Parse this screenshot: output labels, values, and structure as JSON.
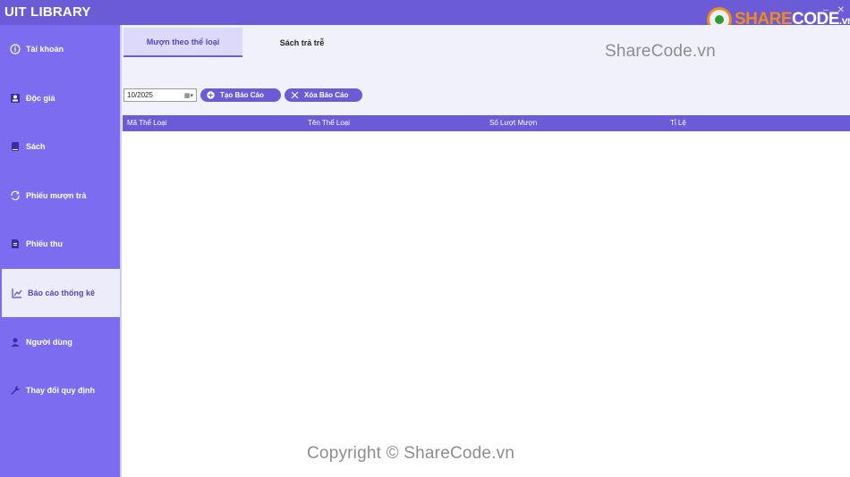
{
  "app": {
    "title": "UIT LIBRARY",
    "minimize": "–",
    "close": "✕"
  },
  "logo": {
    "share": "SHARE",
    "code": "CODE",
    "vn": ".vn"
  },
  "sidebar": {
    "items": [
      {
        "label": "Tài khoản",
        "icon": "account-icon"
      },
      {
        "label": "Độc giả",
        "icon": "reader-icon"
      },
      {
        "label": "Sách",
        "icon": "book-icon"
      },
      {
        "label": "Phiếu mượn trả",
        "icon": "borrow-return-icon"
      },
      {
        "label": "Phiếu thu",
        "icon": "receipt-icon"
      },
      {
        "label": "Báo cáo thống kê",
        "icon": "chart-icon",
        "active": true
      },
      {
        "label": "Người dùng",
        "icon": "user-icon"
      },
      {
        "label": "Thay đổi quy định",
        "icon": "wrench-icon"
      }
    ]
  },
  "tabs": [
    {
      "label": "Mượn theo thể loại",
      "active": true
    },
    {
      "label": "Sách trả trễ",
      "active": false
    }
  ],
  "filter": {
    "month_value": "10/2025"
  },
  "actions": {
    "create_label": "Tạo Báo Cáo",
    "delete_label": "Xóa Báo Cáo"
  },
  "table": {
    "columns": [
      "Mã Thể Loại",
      "Tên Thể Loại",
      "Số Lượt Mượn",
      "Tỉ Lệ"
    ],
    "rows": []
  },
  "watermarks": {
    "top": "ShareCode.vn",
    "bottom": "Copyright © ShareCode.vn"
  },
  "colors": {
    "accent": "#6b5bd6",
    "sidebar": "#7b6cf0",
    "panel": "#f1f1fc"
  }
}
